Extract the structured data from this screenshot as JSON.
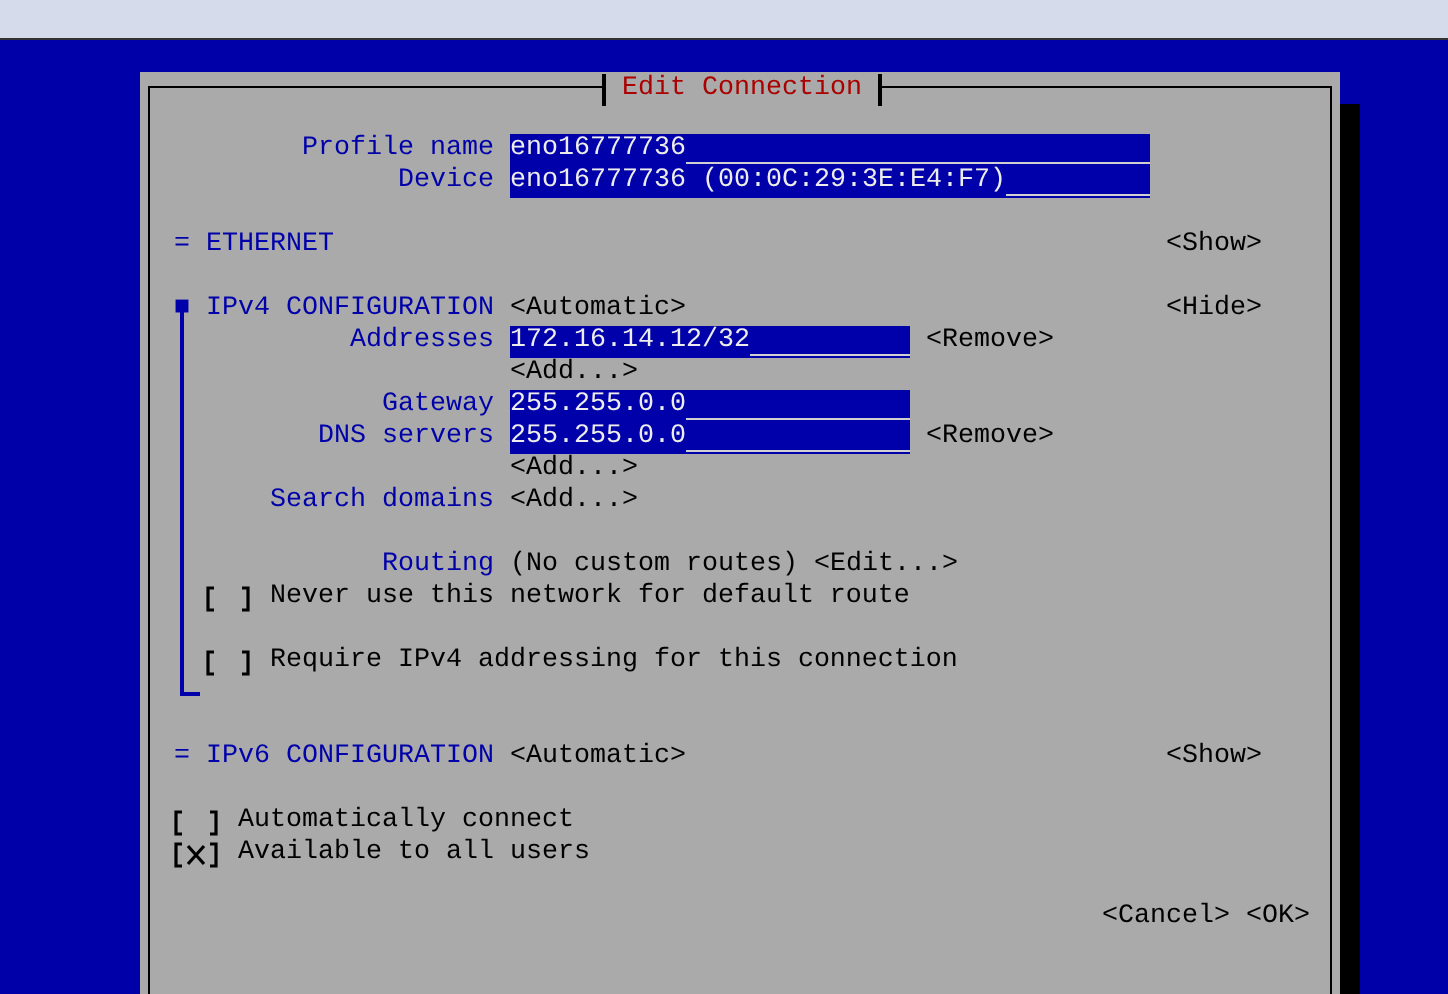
{
  "dialog": {
    "title": "Edit Connection"
  },
  "fields": [
    {
      "label": "Profile name",
      "value": "eno16777736"
    },
    {
      "label": "Device",
      "value": "eno16777736 (00:0C:29:3E:E4:F7)"
    }
  ],
  "sections": [
    {
      "marker": "=",
      "title": "ETHERNET",
      "expanded": false,
      "toggle": "<Show>"
    },
    {
      "marker": "■",
      "title": "IPv4 CONFIGURATION",
      "mode": "<Automatic>",
      "expanded": true,
      "toggle": "<Hide>",
      "rows": [
        {
          "kind": "list",
          "label": "Addresses",
          "entries": [
            {
              "value": "172.16.14.12/32",
              "remove": "<Remove>"
            }
          ],
          "add": "<Add...>"
        },
        {
          "kind": "field",
          "label": "Gateway",
          "value": "255.255.0.0"
        },
        {
          "kind": "list",
          "label": "DNS servers",
          "entries": [
            {
              "value": "255.255.0.0",
              "remove": "<Remove>"
            }
          ],
          "add": "<Add...>"
        },
        {
          "kind": "list",
          "label": "Search domains",
          "entries": [],
          "add": "<Add...>"
        },
        {
          "kind": "blank"
        },
        {
          "kind": "text",
          "label": "Routing",
          "value": "(No custom routes)",
          "action": "<Edit...>"
        },
        {
          "kind": "checkbox",
          "label": "Never use this network for default route",
          "checked": false
        },
        {
          "kind": "blank"
        },
        {
          "kind": "checkbox",
          "label": "Require IPv4 addressing for this connection",
          "checked": false
        }
      ]
    },
    {
      "marker": "=",
      "title": "IPv6 CONFIGURATION",
      "mode": "<Automatic>",
      "expanded": false,
      "toggle": "<Show>"
    }
  ],
  "options": [
    {
      "label": "Automatically connect",
      "checked": false
    },
    {
      "label": "Available to all users",
      "checked": true
    }
  ],
  "buttons": [
    "<Cancel>",
    "<OK>"
  ]
}
